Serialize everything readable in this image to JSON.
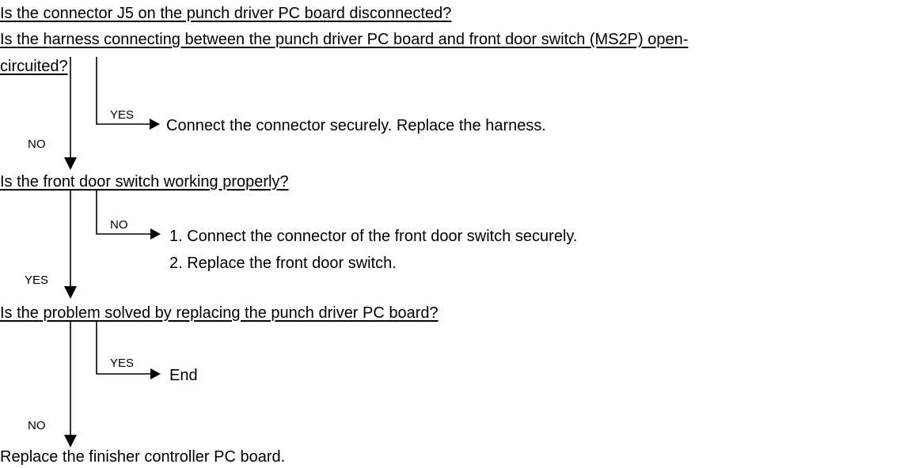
{
  "flowchart": {
    "step1": {
      "question_line1": "Is the connector J5 on the punch driver PC board disconnected?",
      "question_line2": "Is the harness connecting between the punch driver PC board and front door switch (MS2P) open-",
      "question_line3": "circuited?",
      "branch_label": "YES",
      "action": "Connect the connector securely.  Replace the harness.",
      "down_label": "NO"
    },
    "step2": {
      "question": "Is the front door switch working properly?",
      "branch_label": "NO",
      "action_1": "1.  Connect the connector of the front door switch securely.",
      "action_2": "2.  Replace the front door switch.",
      "down_label": "YES"
    },
    "step3": {
      "question": "Is the problem solved by replacing the punch driver PC board?",
      "branch_label": "YES",
      "action": "End",
      "down_label": "NO"
    },
    "final": "Replace the finisher controller PC board."
  }
}
